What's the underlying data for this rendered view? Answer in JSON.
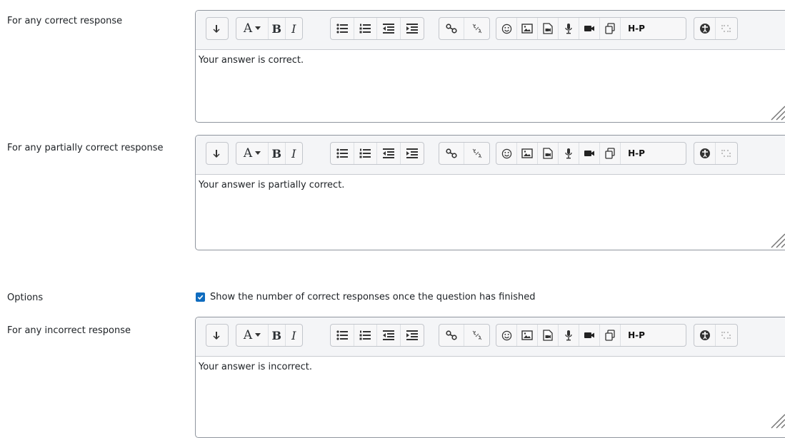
{
  "fields": [
    {
      "label": "For any correct response",
      "content": "Your answer is correct."
    },
    {
      "label": "For any partially correct response",
      "content": "Your answer is partially correct."
    },
    {
      "label": "For any incorrect response",
      "content": "Your answer is incorrect."
    }
  ],
  "options": {
    "label": "Options",
    "checkbox_label": "Show the number of correct responses once the question has finished",
    "checked": true
  },
  "toolbar": {
    "font_label": "A",
    "bold_label": "B",
    "italic_label": "I",
    "h5p_label": "H-P"
  },
  "colors": {
    "accent": "#0f6cbf",
    "border": "#8f959e",
    "toolbar_bg": "#f4f5f7"
  }
}
